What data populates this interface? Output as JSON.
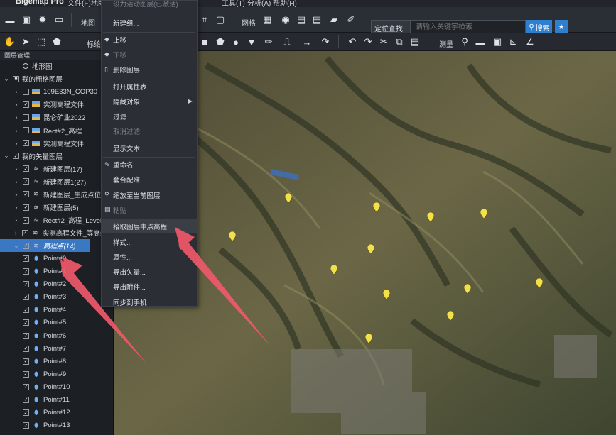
{
  "app": {
    "title": "Bigemap Pro",
    "menus": [
      "文件(F)",
      "地图",
      "工具(T)",
      "分析(A)",
      "帮助(H)"
    ]
  },
  "toolbar": {
    "map_label": "地图",
    "grid_label": "网格",
    "annotate_label": "标绘",
    "measure_label": "测量",
    "search_mode": "定位查找",
    "search_placeholder": "请输入关键字检索",
    "search_button": "搜索"
  },
  "panel": {
    "title": "图层管理",
    "rows": [
      {
        "indent": 1,
        "chev": "",
        "cb": "",
        "icon": "radio",
        "label": "地形图"
      },
      {
        "indent": 0,
        "chev": "⌄",
        "cb": "■",
        "icon": "",
        "label": "我的栅格图层"
      },
      {
        "indent": 1,
        "chev": "›",
        "cb": "",
        "icon": "raster",
        "label": "109E33N_COP30"
      },
      {
        "indent": 1,
        "chev": "›",
        "cb": "✓",
        "icon": "raster",
        "label": "实测高程文件"
      },
      {
        "indent": 1,
        "chev": "›",
        "cb": "",
        "icon": "raster",
        "label": "昆仑矿业2022"
      },
      {
        "indent": 1,
        "chev": "›",
        "cb": "",
        "icon": "raster",
        "label": "Rect#2_高程"
      },
      {
        "indent": 1,
        "chev": "›",
        "cb": "✓",
        "icon": "raster",
        "label": "实测高程文件"
      },
      {
        "indent": 0,
        "chev": "⌄",
        "cb": "✓",
        "icon": "",
        "label": "我的矢量图层"
      },
      {
        "indent": 1,
        "chev": "›",
        "cb": "✓",
        "icon": "layers",
        "label": "新建图层(17)"
      },
      {
        "indent": 1,
        "chev": "›",
        "cb": "✓",
        "icon": "layers",
        "label": "新建图层1(27)"
      },
      {
        "indent": 1,
        "chev": "›",
        "cb": "✓",
        "icon": "layers",
        "label": "新建图层_生成点位(15)"
      },
      {
        "indent": 1,
        "chev": "›",
        "cb": "✓",
        "icon": "layers",
        "label": "新建图层(5)"
      },
      {
        "indent": 1,
        "chev": "›",
        "cb": "✓",
        "icon": "layers",
        "label": "Rect#2_高程_Level_16"
      },
      {
        "indent": 1,
        "chev": "›",
        "cb": "✓",
        "icon": "layers",
        "label": "实测高程文件_等高线(1"
      },
      {
        "indent": 1,
        "chev": "⌄",
        "cb": "✓",
        "icon": "layers",
        "label": "高程点(14)",
        "selected": true
      },
      {
        "indent": 2,
        "chev": "",
        "cb": "✓",
        "icon": "pin",
        "label": "Point#0"
      },
      {
        "indent": 2,
        "chev": "",
        "cb": "✓",
        "icon": "pin",
        "label": "Point#1"
      },
      {
        "indent": 2,
        "chev": "",
        "cb": "✓",
        "icon": "pin",
        "label": "Point#2"
      },
      {
        "indent": 2,
        "chev": "",
        "cb": "✓",
        "icon": "pin",
        "label": "Point#3"
      },
      {
        "indent": 2,
        "chev": "",
        "cb": "✓",
        "icon": "pin",
        "label": "Point#4"
      },
      {
        "indent": 2,
        "chev": "",
        "cb": "✓",
        "icon": "pin",
        "label": "Point#5"
      },
      {
        "indent": 2,
        "chev": "",
        "cb": "✓",
        "icon": "pin",
        "label": "Point#6"
      },
      {
        "indent": 2,
        "chev": "",
        "cb": "✓",
        "icon": "pin",
        "label": "Point#7"
      },
      {
        "indent": 2,
        "chev": "",
        "cb": "✓",
        "icon": "pin",
        "label": "Point#8"
      },
      {
        "indent": 2,
        "chev": "",
        "cb": "✓",
        "icon": "pin",
        "label": "Point#9"
      },
      {
        "indent": 2,
        "chev": "",
        "cb": "✓",
        "icon": "pin",
        "label": "Point#10"
      },
      {
        "indent": 2,
        "chev": "",
        "cb": "✓",
        "icon": "pin",
        "label": "Point#11"
      },
      {
        "indent": 2,
        "chev": "",
        "cb": "✓",
        "icon": "pin",
        "label": "Point#12"
      },
      {
        "indent": 2,
        "chev": "",
        "cb": "✓",
        "icon": "pin",
        "label": "Point#13"
      }
    ]
  },
  "context_menu": {
    "items": [
      {
        "label": "设为活动图层(已激活)",
        "disabled": true,
        "icon": "",
        "icon_name": ""
      },
      {
        "label": "新建组...",
        "icon": "",
        "icon_name": ""
      },
      {
        "label": "上移",
        "icon": "◆",
        "icon_name": "move-up-icon"
      },
      {
        "label": "下移",
        "disabled": true,
        "icon": "◆",
        "icon_name": "move-down-icon"
      },
      {
        "label": "删除图层",
        "icon": "▯",
        "icon_name": "delete-icon"
      },
      {
        "label": "打开属性表...",
        "icon": "",
        "icon_name": ""
      },
      {
        "label": "隐藏对象",
        "submenu": true,
        "icon": "",
        "icon_name": ""
      },
      {
        "label": "过滤...",
        "icon": "",
        "icon_name": ""
      },
      {
        "label": "取消过滤",
        "disabled": true,
        "icon": "",
        "icon_name": ""
      },
      {
        "label": "显示文本",
        "icon": "",
        "icon_name": ""
      },
      {
        "label": "重命名...",
        "icon": "✎",
        "icon_name": "rename-icon"
      },
      {
        "label": "套合配准...",
        "icon": "",
        "icon_name": ""
      },
      {
        "label": "缩放至当前图层",
        "icon": "⚲",
        "icon_name": "zoom-layer-icon"
      },
      {
        "label": "粘贴",
        "disabled": true,
        "icon": "▤",
        "icon_name": "paste-icon"
      },
      {
        "label": "拾取图层中点高程",
        "hover": true,
        "icon": "",
        "icon_name": ""
      },
      {
        "label": "样式...",
        "icon": "",
        "icon_name": ""
      },
      {
        "label": "属性...",
        "icon": "",
        "icon_name": ""
      },
      {
        "label": "导出矢量...",
        "icon": "",
        "icon_name": ""
      },
      {
        "label": "导出附件...",
        "icon": "",
        "icon_name": ""
      },
      {
        "label": "同步到手机",
        "icon": "",
        "icon_name": ""
      }
    ]
  },
  "colors": {
    "accent": "#3a78c4",
    "marker": "#f2e14a",
    "arrow": "#f0596a"
  }
}
